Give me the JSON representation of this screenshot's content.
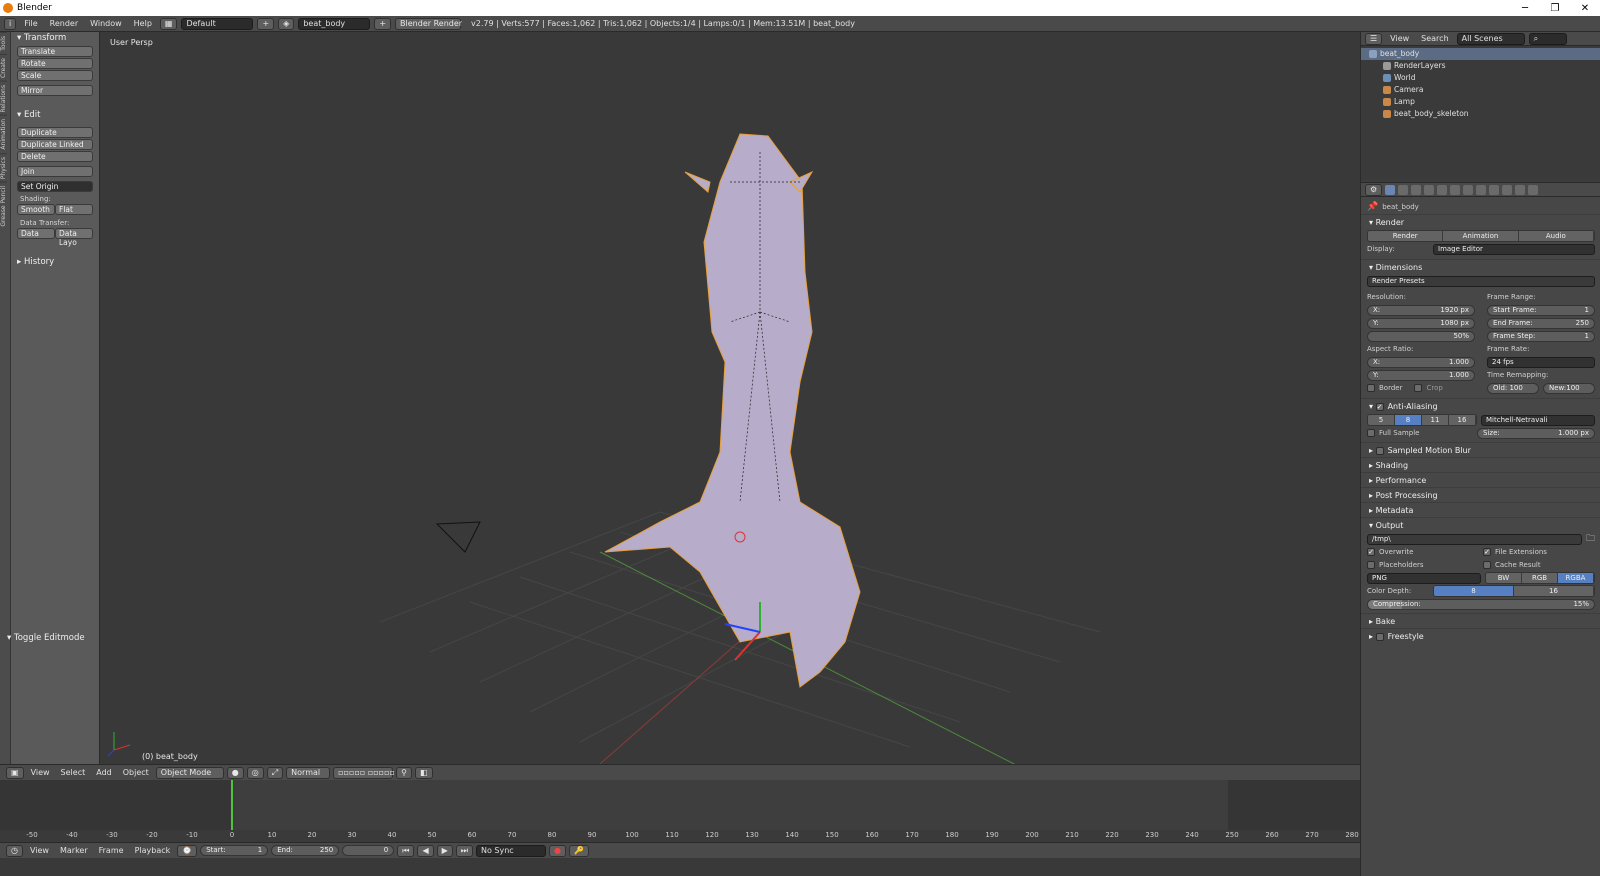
{
  "window": {
    "title": "Blender",
    "min": "─",
    "max": "❐",
    "close": "✕"
  },
  "menubar": {
    "info_icon": "i",
    "menus": [
      "File",
      "Render",
      "Window",
      "Help"
    ],
    "layout": "Default",
    "scene": "beat_body",
    "engine": "Blender Render",
    "stats": "v2.79 | Verts:577 | Faces:1,062 | Tris:1,062 | Objects:1/4 | Lamps:0/1 | Mem:13.51M | beat_body"
  },
  "toolshelf": {
    "tabs": [
      "Tools",
      "Create",
      "Relations",
      "Animation",
      "Physics",
      "Grease Pencil"
    ],
    "transform": {
      "title": "Transform",
      "buttons": [
        "Translate",
        "Rotate",
        "Scale",
        "Mirror"
      ]
    },
    "edit": {
      "title": "Edit",
      "buttons": [
        "Duplicate",
        "Duplicate Linked",
        "Delete",
        "Join"
      ],
      "set_origin": "Set Origin",
      "shading_label": "Shading:",
      "smooth": "Smooth",
      "flat": "Flat",
      "transfer_label": "Data Transfer:",
      "data": "Data",
      "data_layo": "Data Layo"
    },
    "history": "History",
    "toggle_editmode": "Toggle Editmode"
  },
  "viewport": {
    "persp": "User Persp",
    "object": "(0) beat_body"
  },
  "view_header": {
    "menus": [
      "View",
      "Select",
      "Add",
      "Object"
    ],
    "mode": "Object Mode",
    "pivot": "Normal"
  },
  "timeline": {
    "ticks": [
      "-50",
      "-40",
      "-30",
      "-20",
      "-10",
      "0",
      "10",
      "20",
      "30",
      "40",
      "50",
      "60",
      "70",
      "80",
      "90",
      "100",
      "110",
      "120",
      "130",
      "140",
      "150",
      "160",
      "170",
      "180",
      "190",
      "200",
      "210",
      "220",
      "230",
      "240",
      "250",
      "260",
      "270",
      "280"
    ],
    "current_frame_value": 0
  },
  "time_header": {
    "menus": [
      "View",
      "Marker",
      "Frame",
      "Playback"
    ],
    "start_label": "Start:",
    "start": "1",
    "end_label": "End:",
    "end": "250",
    "current": "0",
    "sync": "No Sync"
  },
  "outliner": {
    "menus": [
      "View",
      "Search"
    ],
    "filter": "All Scenes",
    "rows": [
      {
        "name": "beat_body",
        "indent": 0,
        "color": "#8aa0c0"
      },
      {
        "name": "RenderLayers",
        "indent": 1,
        "color": "#9a9a9a"
      },
      {
        "name": "World",
        "indent": 1,
        "color": "#6b8fb5"
      },
      {
        "name": "Camera",
        "indent": 1,
        "color": "#c9884a"
      },
      {
        "name": "Lamp",
        "indent": 1,
        "color": "#c9884a"
      },
      {
        "name": "beat_body_skeleton",
        "indent": 1,
        "color": "#c9884a"
      }
    ]
  },
  "properties": {
    "context": "beat_body",
    "render": {
      "title": "Render",
      "render_btn": "Render",
      "animation_btn": "Animation",
      "audio_btn": "Audio",
      "display_label": "Display:",
      "display": "Image Editor"
    },
    "dimensions": {
      "title": "Dimensions",
      "presets": "Render Presets",
      "resolution": "Resolution:",
      "res_x_l": "X:",
      "res_x": "1920 px",
      "res_y_l": "Y:",
      "res_y": "1080 px",
      "res_pct": "50%",
      "aspect": "Aspect Ratio:",
      "asp_x_l": "X:",
      "asp_x": "1.000",
      "asp_y_l": "Y:",
      "asp_y": "1.000",
      "border": "Border",
      "crop": "Crop",
      "frame_range": "Frame Range:",
      "start_l": "Start Frame:",
      "start": "1",
      "end_l": "End Frame:",
      "end": "250",
      "step_l": "Frame Step:",
      "step": "1",
      "frame_rate": "Frame Rate:",
      "fps": "24 fps",
      "remap": "Time Remapping:",
      "old": "Old: 100",
      "new": "New:100"
    },
    "aa": {
      "title": "Anti-Aliasing",
      "levels": [
        "5",
        "8",
        "11",
        "16"
      ],
      "active": "8",
      "filter": "Mitchell-Netravali",
      "full_sample": "Full Sample",
      "size_l": "Size:",
      "size": "1.000 px"
    },
    "collapsed": [
      "Sampled Motion Blur",
      "Shading",
      "Performance",
      "Post Processing",
      "Metadata"
    ],
    "output": {
      "title": "Output",
      "path": "/tmp\\",
      "overwrite": "Overwrite",
      "file_ext": "File Extensions",
      "placeholders": "Placeholders",
      "cache": "Cache Result",
      "format": "PNG",
      "bw": "BW",
      "rgb": "RGB",
      "rgba": "RGBA",
      "depth_l": "Color Depth:",
      "d8": "8",
      "d16": "16",
      "compression": "Compression:",
      "comp_val": "15%",
      "comp_value": 15
    },
    "bake": "Bake",
    "freestyle": "Freestyle"
  },
  "colors": {
    "accent": "#5680c2",
    "selection_orange": "#e8a03a",
    "mesh": "#b7acc9"
  }
}
